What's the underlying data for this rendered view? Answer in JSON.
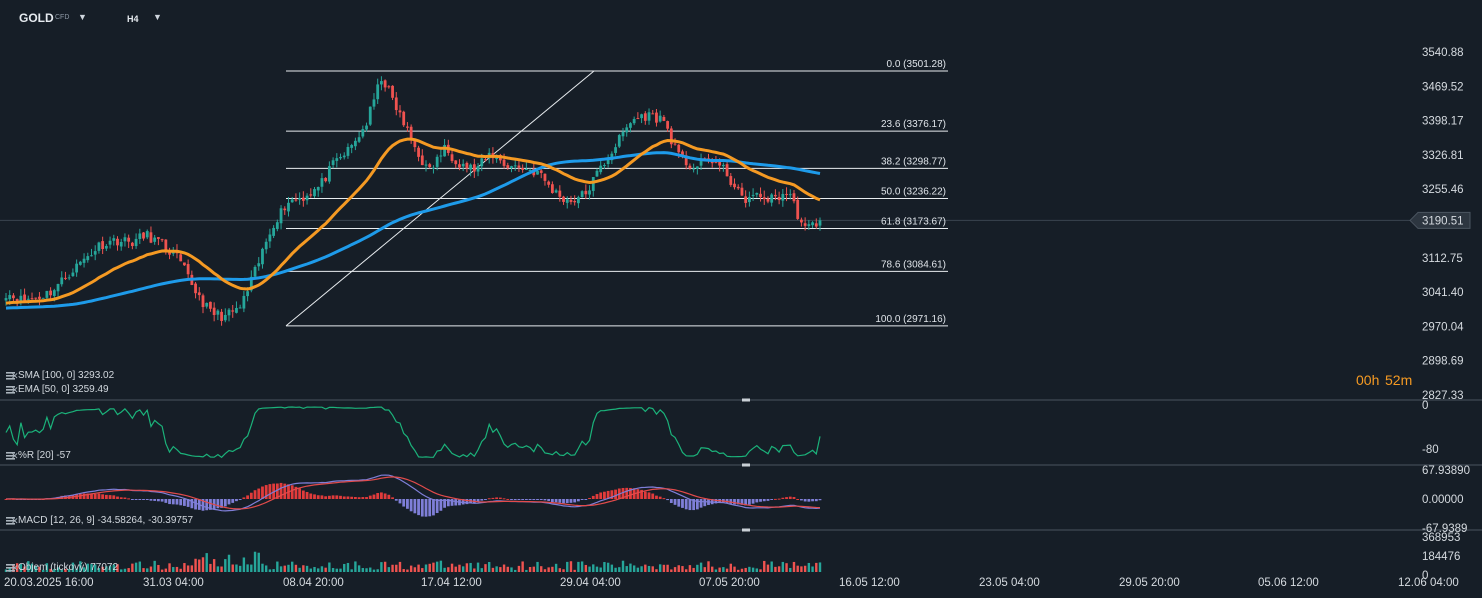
{
  "toolbar": {
    "symbol": "GOLD",
    "symbol_type": "CFD",
    "timeframe": "H4"
  },
  "colors": {
    "background": "#161e27",
    "bull_candle": "#26a69a",
    "bear_candle": "#ef5350",
    "sma": "#1e9bea",
    "ema": "#f59a23",
    "williams_r": "#1bb27a",
    "macd_line": "#7f7fd8",
    "signal_line": "#e24b4b",
    "hist_pos": "#e23b3b",
    "hist_neg": "#7f7fd8",
    "countdown": "#f59a23"
  },
  "chart_data": {
    "type": "candlestick",
    "symbol": "GOLD",
    "timeframe": "H4",
    "x_labels": [
      "20.03.2025 16:00",
      "31.03 04:00",
      "08.04 20:00",
      "17.04 12:00",
      "29.04 04:00",
      "07.05 20:00",
      "16.05 12:00",
      "23.05 04:00",
      "29.05 20:00",
      "05.06 12:00",
      "12.06 04:00"
    ],
    "price_axis_labels": [
      "3540.88",
      "3469.52",
      "3398.17",
      "3326.81",
      "3255.46",
      "3190.51",
      "3112.75",
      "3041.40",
      "2970.04",
      "2898.69",
      "2827.33"
    ],
    "ylim": [
      2827.33,
      3540.88
    ],
    "current_price": 3190.51,
    "close_path": [
      3040,
      3025,
      3030,
      3045,
      3080,
      3110,
      3140,
      3150,
      3145,
      3160,
      3140,
      3110,
      3050,
      3000,
      2990,
      3010,
      3090,
      3180,
      3230,
      3240,
      3260,
      3310,
      3340,
      3390,
      3490,
      3420,
      3350,
      3290,
      3340,
      3310,
      3295,
      3330,
      3305,
      3300,
      3290,
      3250,
      3230,
      3245,
      3300,
      3350,
      3400,
      3410,
      3400,
      3320,
      3300,
      3320,
      3290,
      3235,
      3240,
      3235,
      3250,
      3170,
      3190
    ],
    "candle_count": 220,
    "fibonacci": {
      "high": 3501.28,
      "low": 2971.16,
      "levels": [
        {
          "label": "0.0 (3501.28)",
          "price": 3501.28
        },
        {
          "label": "23.6 (3376.17)",
          "price": 3376.17
        },
        {
          "label": "38.2 (3298.77)",
          "price": 3298.77
        },
        {
          "label": "50.0 (3236.22)",
          "price": 3236.22
        },
        {
          "label": "61.8 (3173.67)",
          "price": 3173.67
        },
        {
          "label": "78.6 (3084.61)",
          "price": 3084.61
        },
        {
          "label": "100.0 (2971.16)",
          "price": 2971.16
        }
      ]
    },
    "overlays": [
      {
        "name": "SMA",
        "label": "SMA [100, 0] 3293.02",
        "period": 100,
        "value": 3293.02
      },
      {
        "name": "EMA",
        "label": "EMA [50, 0] 3259.49",
        "period": 50,
        "value": 3259.49
      }
    ],
    "indicators": {
      "williams_r": {
        "label": "%R [20] -57",
        "axis": [
          "0",
          "-80"
        ],
        "ylim": [
          -100,
          0
        ],
        "value": -57
      },
      "macd": {
        "label": "MACD [12, 26, 9] -34.58264, -30.39757",
        "axis": [
          "67.93890",
          "0.00000",
          "-67.9389"
        ],
        "ylim": [
          -67.9389,
          67.9389
        ],
        "macd": -34.58264,
        "signal": -30.39757
      },
      "volume": {
        "label": "Objem (tickový) 77072",
        "axis": [
          "368953",
          "184476",
          "0"
        ],
        "ylim": [
          0,
          368953
        ],
        "value": 77072
      }
    },
    "countdown": {
      "hours": "00h",
      "minutes": "52m"
    }
  }
}
